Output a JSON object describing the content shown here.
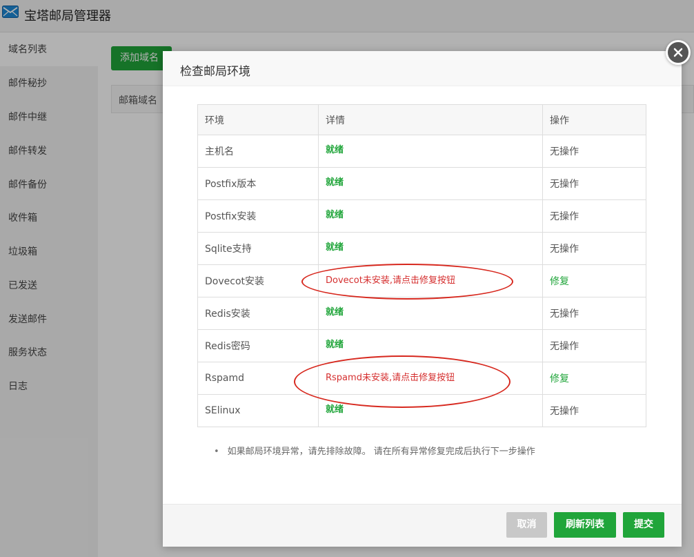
{
  "app": {
    "title": "宝塔邮局管理器"
  },
  "sidebar": {
    "items": [
      {
        "label": "域名列表"
      },
      {
        "label": "邮件秘抄"
      },
      {
        "label": "邮件中继"
      },
      {
        "label": "邮件转发"
      },
      {
        "label": "邮件备份"
      },
      {
        "label": "收件箱"
      },
      {
        "label": "垃圾箱"
      },
      {
        "label": "已发送"
      },
      {
        "label": "发送邮件"
      },
      {
        "label": "服务状态"
      },
      {
        "label": "日志"
      }
    ]
  },
  "main": {
    "add_domain_label": "添加域名",
    "table_header_first": "邮箱域名"
  },
  "modal": {
    "title": "检查邮局环境",
    "columns": [
      "环境",
      "详情",
      "操作"
    ],
    "rows": [
      {
        "env": "主机名",
        "detail": "就绪",
        "action": "无操作"
      },
      {
        "env": "Postfix版本",
        "detail": "就绪",
        "action": "无操作"
      },
      {
        "env": "Postfix安装",
        "detail": "就绪",
        "action": "无操作"
      },
      {
        "env": "Sqlite支持",
        "detail": "就绪",
        "action": "无操作"
      },
      {
        "env": "Dovecot安装",
        "detail": "Dovecot未安装,请点击修复按钮",
        "action": "修复"
      },
      {
        "env": "Redis安装",
        "detail": "就绪",
        "action": "无操作"
      },
      {
        "env": "Redis密码",
        "detail": "就绪",
        "action": "无操作"
      },
      {
        "env": "Rspamd",
        "detail": "Rspamd未安装,请点击修复按钮",
        "action": "修复"
      },
      {
        "env": "SElinux",
        "detail": "就绪",
        "action": "无操作"
      }
    ],
    "note": "如果邮局环境异常，请先排除故障。 请在所有异常修复完成后执行下一步操作",
    "buttons": {
      "cancel": "取消",
      "refresh": "刷新列表",
      "submit": "提交"
    }
  },
  "colors": {
    "accent": "#20a53a",
    "error": "#d52f2f",
    "annotation": "#d7281e"
  }
}
